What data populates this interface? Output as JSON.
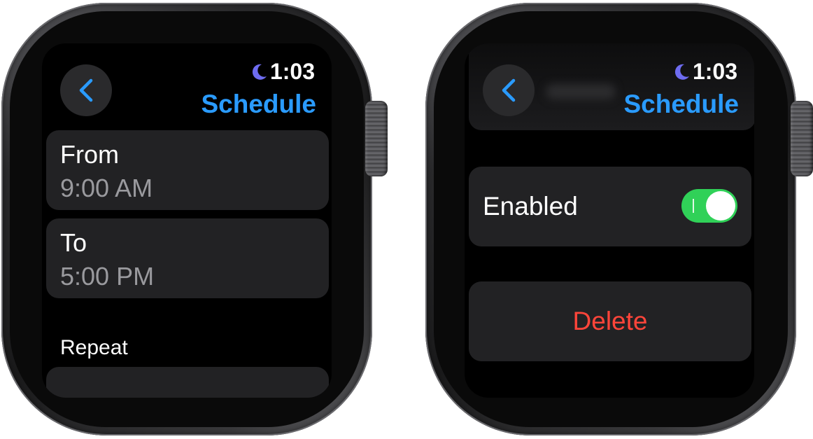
{
  "left_screen": {
    "status": {
      "time": "1:03",
      "focus_icon": "moon-icon"
    },
    "header": {
      "title": "Schedule",
      "back_icon": "chevron-left-icon"
    },
    "rows": [
      {
        "label": "From",
        "value": "9:00 AM"
      },
      {
        "label": "To",
        "value": "5:00 PM"
      }
    ],
    "section_label": "Repeat"
  },
  "right_screen": {
    "status": {
      "time": "1:03",
      "focus_icon": "moon-icon"
    },
    "header": {
      "title": "Schedule",
      "back_icon": "chevron-left-icon"
    },
    "toggle": {
      "label": "Enabled",
      "on": true
    },
    "delete_label": "Delete"
  },
  "colors": {
    "accent": "#2a9bff",
    "moon": "#6e6cf0",
    "toggle_on": "#30d158",
    "destructive": "#ff453a",
    "row_background": "#222224",
    "secondary_text": "#9a9a9e"
  }
}
